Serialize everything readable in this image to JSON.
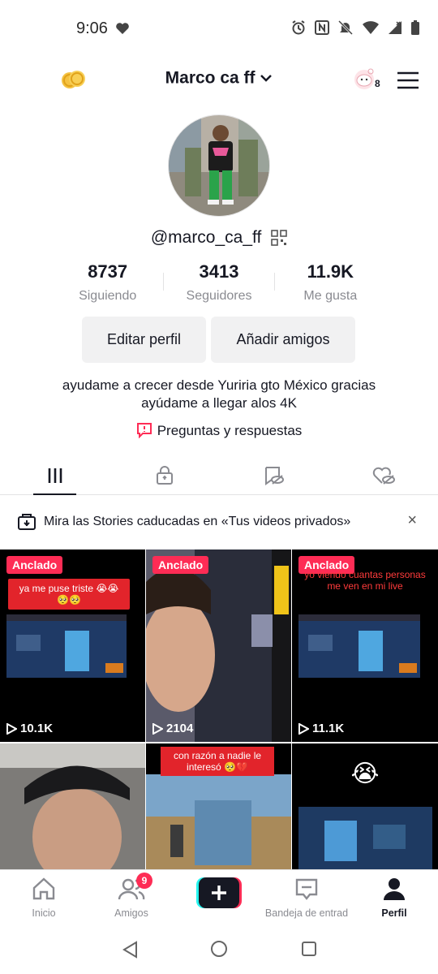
{
  "status_bar": {
    "time": "9:06"
  },
  "header": {
    "username_title": "Marco ca ff",
    "pet_count": "8"
  },
  "profile": {
    "handle": "@marco_ca_ff",
    "stats": [
      {
        "value": "8737",
        "label": "Siguiendo"
      },
      {
        "value": "3413",
        "label": "Seguidores"
      },
      {
        "value": "11.9K",
        "label": "Me gusta"
      }
    ],
    "edit_button": "Editar perfil",
    "add_friends_button": "Añadir amigos",
    "bio_line1": "ayudame a crecer desde Yuriria gto México gracias",
    "bio_line2": "ayúdame a llegar alos 4K",
    "qa_link": "Preguntas y respuestas"
  },
  "banner": {
    "text": "Mira las Stories caducadas en «Tus videos privados»",
    "close": "×"
  },
  "videos": [
    {
      "badge": "Anclado",
      "views": "10.1K",
      "caption": "ya me puse triste 😭😭🥺🥺"
    },
    {
      "badge": "Anclado",
      "views": "2104"
    },
    {
      "badge": "Anclado",
      "views": "11.1K",
      "caption": "yo viendo cuantas personas me ven en mi live"
    },
    {},
    {
      "caption": "con razón a nadie le interesó 🥺💔"
    },
    {
      "caption": "😭"
    }
  ],
  "bottom_nav": [
    {
      "label": "Inicio"
    },
    {
      "label": "Amigos",
      "badge": "9"
    },
    {
      "label": ""
    },
    {
      "label": "Bandeja de entrad"
    },
    {
      "label": "Perfil"
    }
  ],
  "colors": {
    "accent": "#fe2c55",
    "text": "#161823",
    "muted": "#8a8b91",
    "button_bg": "#f1f1f2"
  }
}
